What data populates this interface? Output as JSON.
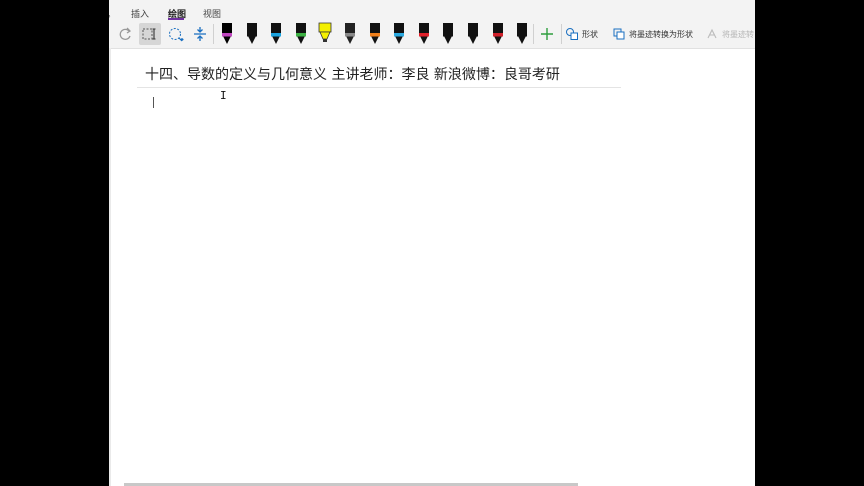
{
  "tabs": {
    "partial_label": "。",
    "insert": "插入",
    "draw": "绘图",
    "view": "视图"
  },
  "ribbon": {
    "shapes_label": "形状",
    "ink_to_shape_label": "将墨迹转换为形状",
    "ink_to_text_label": "将墨迹转",
    "pens": [
      {
        "icon": "pen-icon",
        "color": "#000000",
        "band": "#c046c0"
      },
      {
        "icon": "pen-icon",
        "color": "#111111",
        "band": "#111111"
      },
      {
        "icon": "pen-icon",
        "color": "#111111",
        "band": "#1aa3e0"
      },
      {
        "icon": "pen-icon",
        "color": "#111111",
        "band": "#3cb043"
      },
      {
        "icon": "highlighter-icon",
        "color": "#f4f000",
        "band": "#f4f000"
      },
      {
        "icon": "pen-icon",
        "color": "#222222",
        "band": "#888888"
      },
      {
        "icon": "pen-icon",
        "color": "#111111",
        "band": "#f07f1a"
      },
      {
        "icon": "pen-icon",
        "color": "#111111",
        "band": "#2aa9e0"
      },
      {
        "icon": "pen-icon",
        "color": "#111111",
        "band": "#e0202a"
      },
      {
        "icon": "pen-icon",
        "color": "#111111",
        "band": "#111111"
      },
      {
        "icon": "pen-icon",
        "color": "#111111",
        "band": "#111111"
      },
      {
        "icon": "pen-icon",
        "color": "#111111",
        "band": "#d0202a"
      },
      {
        "icon": "pen-icon",
        "color": "#111111",
        "band": "#111111"
      }
    ]
  },
  "page": {
    "title": "十四、导数的定义与几何意义  主讲老师：李良    新浪微博：良哥考研"
  },
  "colors": {
    "accent": "#7030a0",
    "ribbon_bg": "#f3f3f3"
  }
}
